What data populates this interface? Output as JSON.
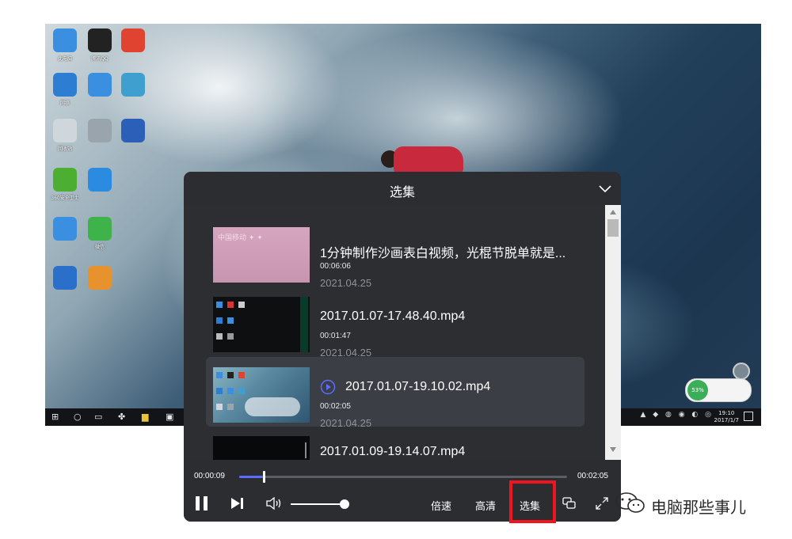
{
  "desktop": {
    "icons": [
      {
        "label": "此电脑",
        "color": "#3a8fe0"
      },
      {
        "label": "腾讯QQ",
        "color": "#222"
      },
      {
        "label": "",
        "color": "#e04430"
      },
      {
        "label": "网络",
        "color": "#2d7dd2"
      },
      {
        "label": "",
        "color": "#3a8fe0"
      },
      {
        "label": "",
        "color": "#3fa0d0"
      },
      {
        "label": "回收站",
        "color": "#cfd6dc"
      },
      {
        "label": "",
        "color": "#9aa4ad"
      },
      {
        "label": "",
        "color": "#2b5fb8"
      },
      {
        "label": "360安全卫士",
        "color": "#4caf32"
      },
      {
        "label": "",
        "color": "#2b8be0"
      },
      {
        "label": "",
        "color": "#1e6fd0"
      },
      {
        "label": "",
        "color": "#3a8fe0"
      },
      {
        "label": "微信",
        "color": "#3db34a"
      },
      {
        "label": "",
        "color": "#d03a3a"
      },
      {
        "label": "",
        "color": "#2a6fc9"
      },
      {
        "label": "",
        "color": "#e8922e"
      },
      {
        "label": "",
        "color": "#3a8fe0"
      }
    ],
    "taskbar": {
      "clock_time": "19:10",
      "clock_date": "2017/1/7"
    },
    "widget_percent": "53%"
  },
  "player": {
    "panel_title": "选集",
    "episodes": [
      {
        "title": "1分钟制作沙画表白视频，光棍节脱单就是...",
        "duration": "00:06:06",
        "date": "2021.04.25",
        "active": false,
        "thumb_text": "中国移动 ✦ ✦"
      },
      {
        "title": "2017.01.07-17.48.40.mp4",
        "duration": "00:01:47",
        "date": "2021.04.25",
        "active": false
      },
      {
        "title": "2017.01.07-19.10.02.mp4",
        "duration": "00:02:05",
        "date": "2021.04.25",
        "active": true
      },
      {
        "title": "2017.01.09-19.14.07.mp4",
        "duration": "",
        "date": "",
        "active": false
      }
    ],
    "current_time": "00:00:09",
    "total_time": "00:02:05",
    "progress_fraction": 0.072,
    "volume_fraction": 1.0,
    "buttons": {
      "speed": "倍速",
      "quality": "高清",
      "episodes": "选集"
    },
    "accent_color": "#5b6dff",
    "highlight_color": "#f0141e"
  },
  "watermark": {
    "text": "电脑那些事儿"
  }
}
